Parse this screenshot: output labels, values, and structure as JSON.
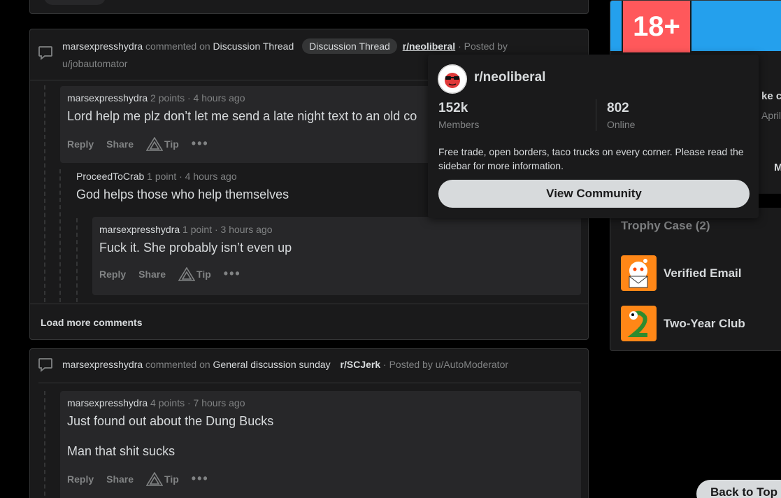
{
  "post1": {
    "user": "marsexpresshydra",
    "verb": "commented on",
    "thread": "Discussion Thread",
    "flair": "Discussion Thread",
    "subreddit": "r/neoliberal",
    "posted_by_label": "· Posted by",
    "op": "u/jobautomator",
    "comments": [
      {
        "user": "marsexpresshydra",
        "points": "2 points",
        "time": "· 4 hours ago",
        "body": "Lord help me plz don’t let me send a late night text to an old co"
      },
      {
        "user": "ProceedToCrab",
        "points": "1 point",
        "time": "· 4 hours ago",
        "body": "God helps those who help themselves"
      },
      {
        "user": "marsexpresshydra",
        "points": "1 point",
        "time": "· 3 hours ago",
        "body": "Fuck it. She probably isn’t even up"
      }
    ],
    "load_more": "Load more comments"
  },
  "post2": {
    "user": "marsexpresshydra",
    "verb": "commented on",
    "thread": "General discussion sunday",
    "subreddit": "r/SCJerk",
    "posted_by": "· Posted by u/AutoModerator",
    "comment": {
      "user": "marsexpresshydra",
      "points": "4 points",
      "time": "· 7 hours ago",
      "body_lines": [
        "Just found out about the Dung Bucks",
        "Man that shit sucks"
      ]
    }
  },
  "actions": {
    "reply": "Reply",
    "share": "Share",
    "tip": "Tip",
    "more": "•••"
  },
  "sidebar": {
    "nsfw_label": "18+",
    "partial_texts": [
      "ke c",
      "April",
      "M"
    ],
    "trophy_title": "Trophy Case (2)",
    "trophies": [
      "Verified Email",
      "Two-Year Club"
    ]
  },
  "popup": {
    "name": "r/neoliberal",
    "members": "152k",
    "members_label": "Members",
    "online": "802",
    "online_label": "Online",
    "description": "Free trade, open borders, taco trucks on every corner. Please read the sidebar for more information.",
    "button": "View Community"
  },
  "back_to_top": "Back to Top",
  "colors": {
    "card": "#1a1a1b",
    "comment": "#272729",
    "border": "#343536",
    "muted": "#818384",
    "text": "#d7dadc",
    "nsfw": "#ff585b",
    "banner": "#24a0ed"
  }
}
